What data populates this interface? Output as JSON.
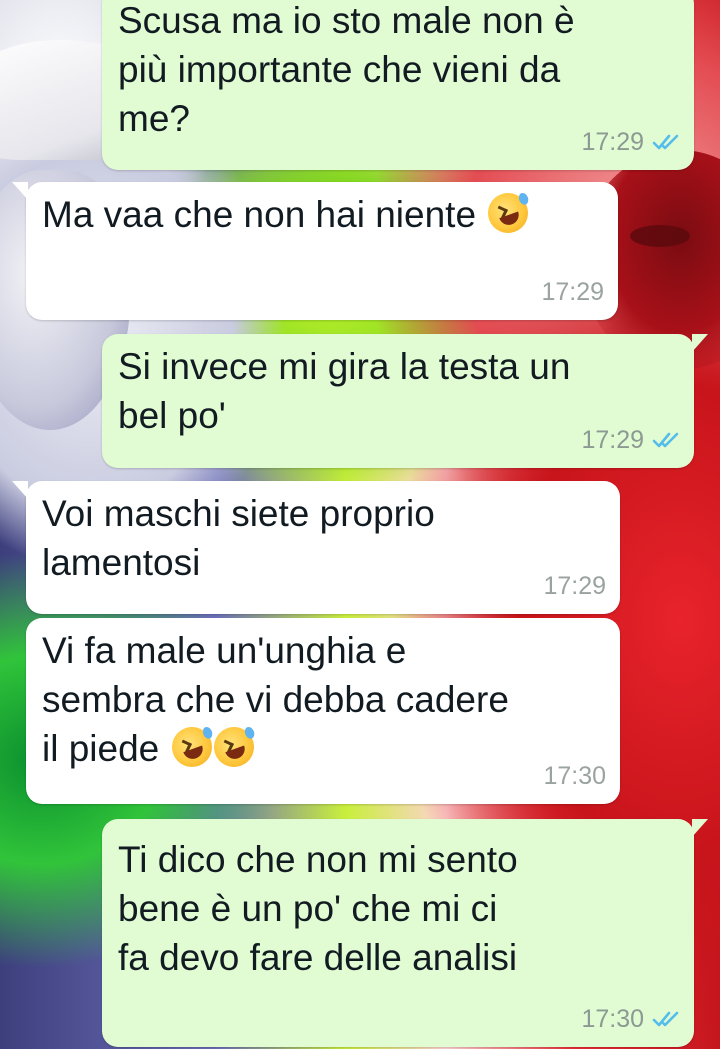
{
  "messages": [
    {
      "direction": "out",
      "text": "Scusa ma io sto male non è\npiù importante che vieni da\nme?",
      "time": "17:29",
      "status_icon": "double-check-blue-icon"
    },
    {
      "direction": "in",
      "text": "Ma vaa che non hai niente ",
      "emoji_count": 1,
      "emoji": "rolling-on-the-floor-laughing-icon",
      "time": "17:29"
    },
    {
      "direction": "out",
      "text": "Si invece mi gira la testa un\nbel po'",
      "time": "17:29",
      "status_icon": "double-check-blue-icon"
    },
    {
      "direction": "in",
      "text": "Voi maschi siete proprio\nlamentosi",
      "time": "17:29"
    },
    {
      "direction": "in",
      "text": "Vi fa male un'unghia e\nsembra che vi debba cadere\nil piede ",
      "emoji_count": 2,
      "emoji": "rolling-on-the-floor-laughing-icon",
      "time": "17:30"
    },
    {
      "direction": "out",
      "text": "Ti dico che non mi sento\nbene è un po' che mi ci\nfa devo fare delle analisi",
      "time": "17:30",
      "status_icon": "double-check-blue-icon"
    }
  ],
  "colors": {
    "outgoing_bubble": "#e1fbd2",
    "incoming_bubble": "#ffffff",
    "read_ticks": "#53bdeb"
  }
}
